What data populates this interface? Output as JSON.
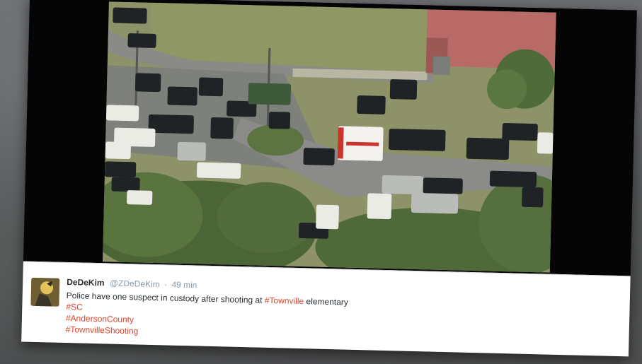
{
  "tweet": {
    "author_name": "DeDeKim",
    "handle": "@ZDeDeKim",
    "separator": "·",
    "time": "49 min",
    "text_before": "Police have one suspect in custody after shooting at ",
    "text_hashtag": "#Townville",
    "text_after": " elementary",
    "hashtags": [
      "#SC",
      "#AndersonCounty",
      "#TownvilleShooting"
    ]
  },
  "colors": {
    "hashtag": "#e0452a",
    "name": "#292f33",
    "meta": "#8899a6"
  },
  "icons": {
    "avatar": "profile-avatar"
  }
}
